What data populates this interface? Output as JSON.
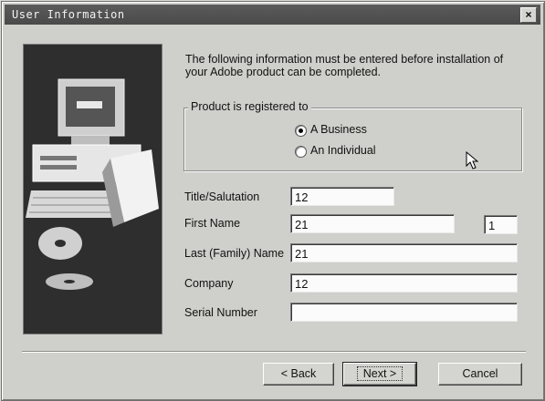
{
  "window": {
    "title": "User Information",
    "close_label": "×"
  },
  "intro_text": "The following information must be entered before installation of your Adobe product can be completed.",
  "registration": {
    "group_label": "Product is registered to",
    "options": [
      {
        "label": "A Business",
        "selected": true
      },
      {
        "label": "An Individual",
        "selected": false
      }
    ]
  },
  "fields": {
    "title": {
      "label": "Title/Salutation",
      "value": "12"
    },
    "first_name": {
      "label": "First Name",
      "value": "21",
      "initial_value": "1"
    },
    "last_name": {
      "label": "Last (Family) Name",
      "value": "21"
    },
    "company": {
      "label": "Company",
      "value": "12"
    },
    "serial": {
      "label": "Serial Number",
      "value": ""
    }
  },
  "buttons": {
    "back": "< Back",
    "next": "Next >",
    "cancel": "Cancel"
  },
  "icons": {
    "close": "close-icon",
    "cursor": "mouse-cursor-icon",
    "illustration": "computer-illustration"
  }
}
